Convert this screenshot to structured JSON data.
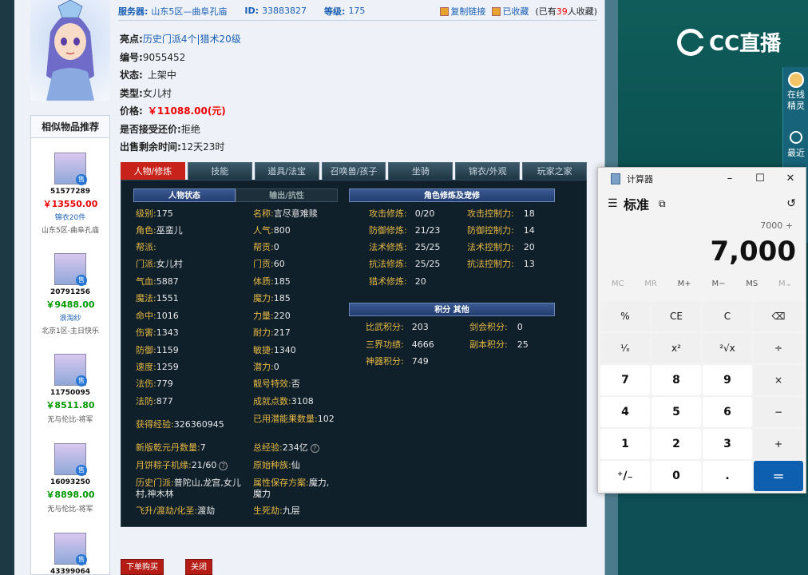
{
  "header": {
    "server_label": "服务器:",
    "server_value": "山东5区—曲阜孔庙",
    "id_label": "ID:",
    "id_value": "33883827",
    "level_label": "等级:",
    "level_value": "175",
    "copy_link": "复制链接",
    "favorited": "已收藏",
    "fav_count_prefix": "(已有",
    "fav_count": "39",
    "fav_count_suffix": "人收藏)"
  },
  "details": [
    {
      "key": "亮点:",
      "value": "历史门派4个|猎术20级",
      "style": "blue"
    },
    {
      "key": "编号:",
      "value": "9055452",
      "style": ""
    },
    {
      "key": "状态:",
      "value": "上架中",
      "style": ""
    },
    {
      "key": "类型:",
      "value": "女儿村",
      "style": ""
    },
    {
      "key": "价格:",
      "value": "￥11088.00(元)",
      "style": "price"
    },
    {
      "key": "是否接受还价:",
      "value": "拒绝",
      "style": ""
    },
    {
      "key": "出售剩余时间:",
      "value": "12天23时",
      "style": ""
    }
  ],
  "tabs": [
    "人物/修炼",
    "技能",
    "道具/法宝",
    "召唤兽/孩子",
    "坐骑",
    "锦衣/外观",
    "玩家之家"
  ],
  "sections": {
    "char_status": "人物状态",
    "output_resist": "输出/抗性",
    "cultivation": "角色修炼及宠修",
    "points_other": "积分 其他"
  },
  "stats_left": [
    {
      "k": "级别:",
      "v": "175"
    },
    {
      "k": "角色:",
      "v": "巫蛮儿"
    },
    {
      "k": "帮派:",
      "v": ""
    },
    {
      "k": "门派:",
      "v": "女儿村"
    },
    {
      "k": "气血:",
      "v": "5887"
    },
    {
      "k": "魔法:",
      "v": "1551"
    },
    {
      "k": "命中:",
      "v": "1016"
    },
    {
      "k": "伤害:",
      "v": "1343"
    },
    {
      "k": "防御:",
      "v": "1159"
    },
    {
      "k": "速度:",
      "v": "1259"
    },
    {
      "k": "法伤:",
      "v": "779"
    },
    {
      "k": "法防:",
      "v": "877"
    }
  ],
  "stats_mid": [
    {
      "k": "名称:",
      "v": "言尽意难赎"
    },
    {
      "k": "人气:",
      "v": "800"
    },
    {
      "k": "帮贡:",
      "v": "0"
    },
    {
      "k": "门贡:",
      "v": "60"
    },
    {
      "k": "体质:",
      "v": "185"
    },
    {
      "k": "魔力:",
      "v": "185"
    },
    {
      "k": "力量:",
      "v": "220"
    },
    {
      "k": "耐力:",
      "v": "217"
    },
    {
      "k": "敏捷:",
      "v": "1340"
    },
    {
      "k": "潜力:",
      "v": "0"
    },
    {
      "k": "靓号特效:",
      "v": "否"
    },
    {
      "k": "成就点数:",
      "v": "3108"
    }
  ],
  "stats_extra": {
    "exp_k": "获得经验:",
    "exp_v": "326360945",
    "used_fruit_k": "已用潜能果数量:",
    "used_fruit_v": "102",
    "qianyuan_k": "新版乾元丹数量:",
    "qianyuan_v": "7",
    "total_exp_k": "总经验:",
    "total_exp_v": "234亿",
    "zongzi_k": "月饼粽子机缘:",
    "zongzi_v": "21/60",
    "origin_k": "原始种族:",
    "origin_v": "仙",
    "history_k": "历史门派:",
    "history_v": "普陀山,龙宫,女儿村,神木林",
    "attr_save_k": "属性保存方案:",
    "attr_save_v": "魔力,魔力",
    "ascend_k": "飞升/渡劫/化圣:",
    "ascend_v": "渡劫",
    "life_death_k": "生死劫:",
    "life_death_v": "九层"
  },
  "cultivation_left": [
    {
      "k": "攻击修炼:",
      "v": "0/20"
    },
    {
      "k": "防御修炼:",
      "v": "21/23"
    },
    {
      "k": "法术修炼:",
      "v": "25/25"
    },
    {
      "k": "抗法修炼:",
      "v": "25/25"
    },
    {
      "k": "猎术修炼:",
      "v": "20"
    }
  ],
  "cultivation_right": [
    {
      "k": "攻击控制力:",
      "v": "18"
    },
    {
      "k": "防御控制力:",
      "v": "14"
    },
    {
      "k": "法术控制力:",
      "v": "20"
    },
    {
      "k": "抗法控制力:",
      "v": "13"
    }
  ],
  "points_left": [
    {
      "k": "比武积分:",
      "v": "203"
    },
    {
      "k": "三界功绩:",
      "v": "4666"
    },
    {
      "k": "神器积分:",
      "v": "749"
    }
  ],
  "points_right": [
    {
      "k": "剑会积分:",
      "v": "0"
    },
    {
      "k": "副本积分:",
      "v": "25"
    }
  ],
  "buttons": {
    "buy": "下单购买",
    "close": "关闭"
  },
  "similar": {
    "title": "相似物品推荐",
    "sell_badge": "售",
    "items": [
      {
        "id": "51577289",
        "price": "￥13550.00",
        "color": "red",
        "tag": "锦衣20件",
        "server": "山东5区-曲阜孔庙"
      },
      {
        "id": "20791256",
        "price": "￥9488.00",
        "color": "green",
        "tag": "浪淘纱",
        "server": "北京1区-主日快乐"
      },
      {
        "id": "11750095",
        "price": "￥8511.80",
        "color": "green",
        "tag": "",
        "server": "无与伦比-将军"
      },
      {
        "id": "16093250",
        "price": "￥8898.00",
        "color": "green",
        "tag": "",
        "server": "无与伦比-将军"
      },
      {
        "id": "43399064",
        "price": "",
        "color": "green",
        "tag": "",
        "server": ""
      }
    ]
  },
  "cc": {
    "logo": "CC直播",
    "online_label": "在线精灵",
    "recent_label": "最近"
  },
  "calculator": {
    "title": "计算器",
    "mode": "标准",
    "expression": "7000 +",
    "display": "7,000",
    "memory": [
      "MC",
      "MR",
      "M+",
      "M−",
      "MS",
      "M⌄"
    ],
    "keys": [
      "%",
      "CE",
      "C",
      "⌫",
      "¹⁄ₓ",
      "x²",
      "²√x",
      "÷",
      "7",
      "8",
      "9",
      "×",
      "4",
      "5",
      "6",
      "−",
      "1",
      "2",
      "3",
      "+",
      "⁺∕₋",
      "0",
      ".",
      "="
    ]
  },
  "colors": {
    "accent_red": "#c8231b",
    "link_blue": "#1a5fb4",
    "stat_key": "#e6b843",
    "calc_equals": "#0f5fb0"
  }
}
